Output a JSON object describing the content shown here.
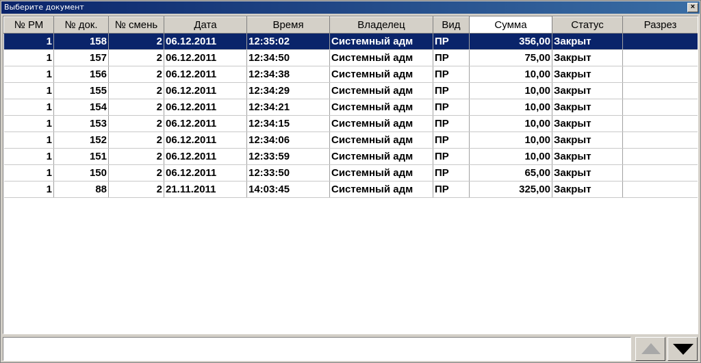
{
  "window": {
    "title": "Выберите документ",
    "close_glyph": "×"
  },
  "table": {
    "columns": [
      "№ РМ",
      "№ док.",
      "№ смень",
      "Дата",
      "Время",
      "Владелец",
      "Вид",
      "Сумма",
      "Статус",
      "Разрез"
    ],
    "sorted_column": "Сумма",
    "selected_row": 0,
    "rows": [
      [
        "1",
        "158",
        "2",
        "06.12.2011",
        "12:35:02",
        "Системный адм",
        "ПР",
        "356,00",
        "Закрыт",
        ""
      ],
      [
        "1",
        "157",
        "2",
        "06.12.2011",
        "12:34:50",
        "Системный адм",
        "ПР",
        "75,00",
        "Закрыт",
        ""
      ],
      [
        "1",
        "156",
        "2",
        "06.12.2011",
        "12:34:38",
        "Системный адм",
        "ПР",
        "10,00",
        "Закрыт",
        ""
      ],
      [
        "1",
        "155",
        "2",
        "06.12.2011",
        "12:34:29",
        "Системный адм",
        "ПР",
        "10,00",
        "Закрыт",
        ""
      ],
      [
        "1",
        "154",
        "2",
        "06.12.2011",
        "12:34:21",
        "Системный адм",
        "ПР",
        "10,00",
        "Закрыт",
        ""
      ],
      [
        "1",
        "153",
        "2",
        "06.12.2011",
        "12:34:15",
        "Системный адм",
        "ПР",
        "10,00",
        "Закрыт",
        ""
      ],
      [
        "1",
        "152",
        "2",
        "06.12.2011",
        "12:34:06",
        "Системный адм",
        "ПР",
        "10,00",
        "Закрыт",
        ""
      ],
      [
        "1",
        "151",
        "2",
        "06.12.2011",
        "12:33:59",
        "Системный адм",
        "ПР",
        "10,00",
        "Закрыт",
        ""
      ],
      [
        "1",
        "150",
        "2",
        "06.12.2011",
        "12:33:50",
        "Системный адм",
        "ПР",
        "65,00",
        "Закрыт",
        ""
      ],
      [
        "1",
        "88",
        "2",
        "21.11.2011",
        "14:03:45",
        "Системный адм",
        "ПР",
        "325,00",
        "Закрыт",
        ""
      ]
    ]
  },
  "footer": {
    "input_value": "",
    "up_icon": "triangle-up-icon",
    "down_icon": "triangle-down-icon"
  },
  "colors": {
    "selection": "#0a246a",
    "face": "#d4d0c8"
  }
}
